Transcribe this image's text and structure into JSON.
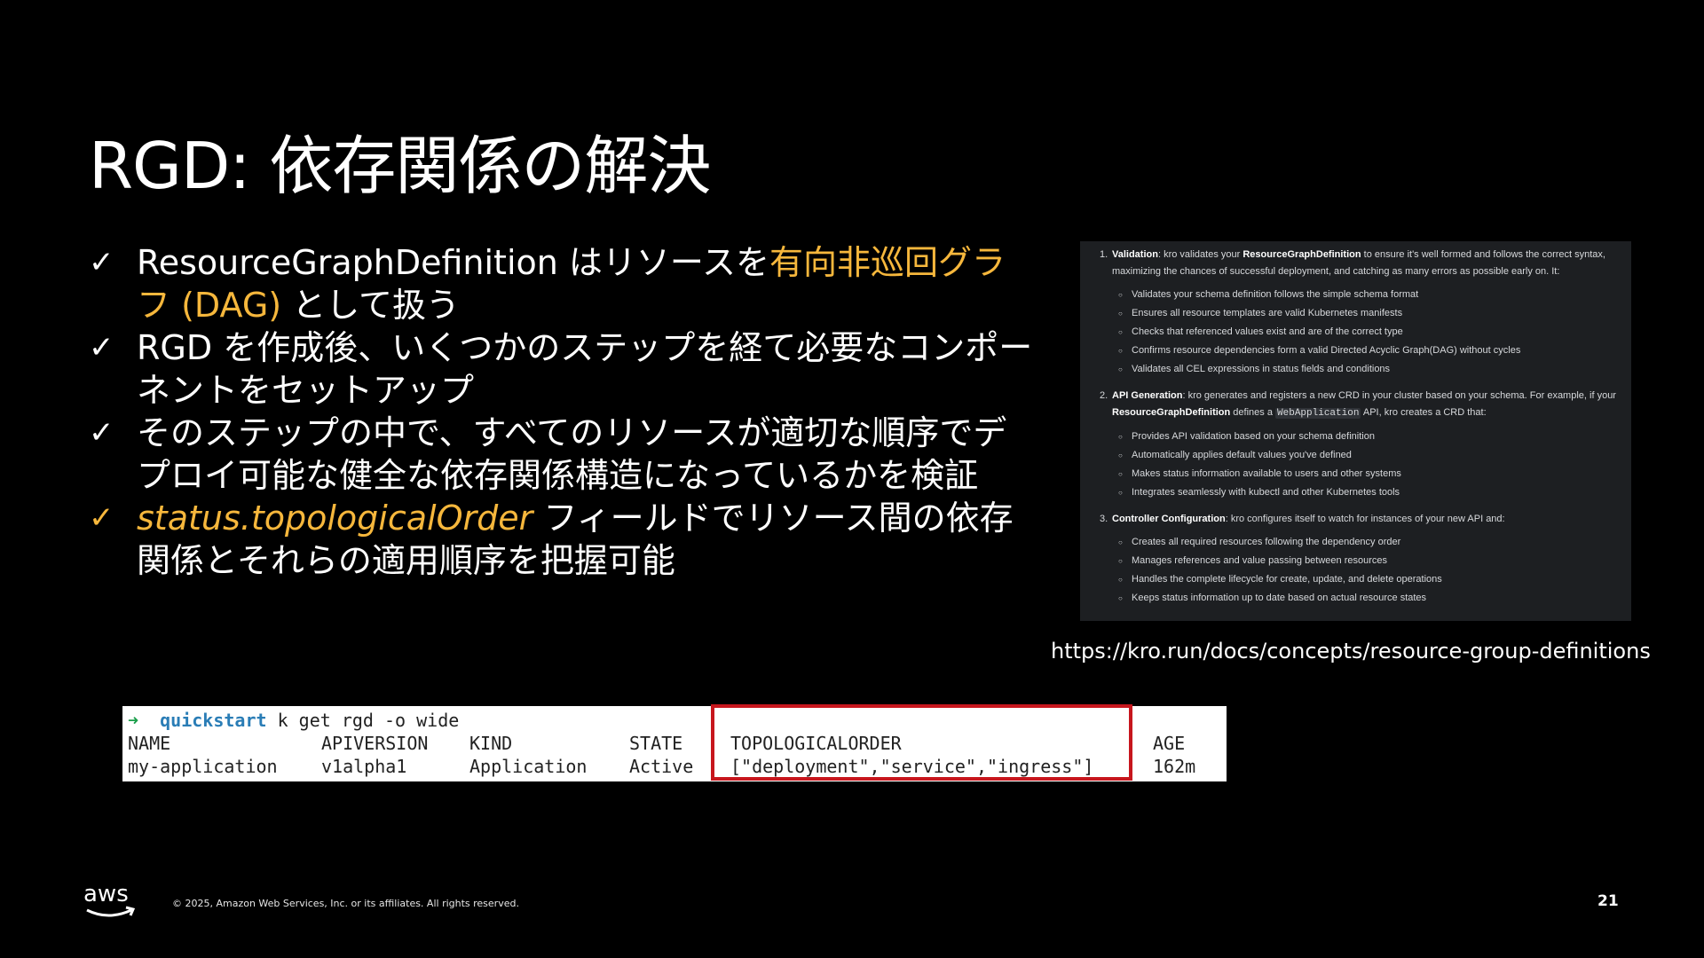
{
  "slide": {
    "title": "RGD: 依存関係の解決",
    "bullets": [
      {
        "check": "✓",
        "parts": [
          {
            "text": "ResourceGraphDefinition はリソースを",
            "style": ""
          },
          {
            "text": "有向非巡回グラフ (DAG)",
            "style": "hl"
          },
          {
            "text": " として扱う",
            "style": ""
          }
        ],
        "highlight": false
      },
      {
        "check": "✓",
        "parts": [
          {
            "text": "RGD を作成後、いくつかのステップを経て必要なコンポーネントをセットアップ",
            "style": ""
          }
        ],
        "highlight": false
      },
      {
        "check": "✓",
        "parts": [
          {
            "text": "そのステップの中で、すべてのリソースが適切な順序でデプロイ可能な健全な依存関係構造になっているかを検証",
            "style": ""
          }
        ],
        "highlight": false
      },
      {
        "check": "✓",
        "parts": [
          {
            "text": "status.topologicalOrder",
            "style": "hl it"
          },
          {
            "text": " フィールドでリソース間の依存関係とそれらの適用順序を把握可能",
            "style": ""
          }
        ],
        "highlight": true
      }
    ],
    "url": "https://kro.run/docs/concepts/resource-group-definitions",
    "copyright": "© 2025, Amazon Web Services, Inc. or its affiliates. All rights reserved.",
    "page_number": "21",
    "logo_text": "aws"
  },
  "doc": {
    "sections": [
      {
        "num": "1.",
        "bold": "Validation",
        "text": ": kro validates your ",
        "bold2": "ResourceGraphDefinition",
        "text2": " to ensure it's well formed and follows the correct syntax, maximizing the chances of successful deployment, and catching as many errors as possible early on. It:",
        "items": [
          "Validates your schema definition follows the simple schema format",
          "Ensures all resource templates are valid Kubernetes manifests",
          "Checks that referenced values exist and are of the correct type",
          "Confirms resource dependencies form a valid Directed Acyclic Graph(DAG) without cycles",
          "Validates all CEL expressions in status fields and conditions"
        ]
      },
      {
        "num": "2.",
        "bold": "API Generation",
        "text": ": kro generates and registers a new CRD in your cluster based on your schema. For example, if your ",
        "bold2": "ResourceGraphDefinition",
        "text2": " defines a ",
        "code": "WebApplication",
        "text3": " API, kro creates a CRD that:",
        "items": [
          "Provides API validation based on your schema definition",
          "Automatically applies default values you've defined",
          "Makes status information available to users and other systems",
          "Integrates seamlessly with kubectl and other Kubernetes tools"
        ]
      },
      {
        "num": "3.",
        "bold": "Controller Configuration",
        "text": ": kro configures itself to watch for instances of your new API and:",
        "items": [
          "Creates all required resources following the dependency order",
          "Manages references and value passing between resources",
          "Handles the complete lifecycle for create, update, and delete operations",
          "Keeps status information up to date based on actual resource states"
        ]
      }
    ]
  },
  "terminal": {
    "prompt_arrow": "➜",
    "cwd": "quickstart",
    "command": " k get rgd -o wide",
    "headers": [
      "NAME",
      "APIVERSION",
      "KIND",
      "STATE",
      "TOPOLOGICALORDER",
      "AGE"
    ],
    "row": [
      "my-application",
      "v1alpha1",
      "Application",
      "Active",
      "[\"deployment\",\"service\",\"ingress\"]",
      "162m"
    ],
    "highlight_color": "#c7161d"
  }
}
